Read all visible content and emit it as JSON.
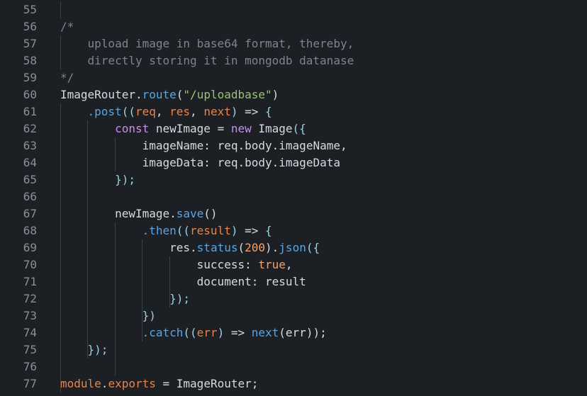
{
  "editor": {
    "lines": [
      {
        "number": "55",
        "indent": "",
        "tokens": []
      },
      {
        "number": "56",
        "indent": "",
        "tokens": [
          {
            "t": "/*",
            "c": "comment"
          }
        ]
      },
      {
        "number": "57",
        "indent": "    ",
        "tokens": [
          {
            "t": "upload image in base64 format, thereby,",
            "c": "comment"
          }
        ]
      },
      {
        "number": "58",
        "indent": "    ",
        "tokens": [
          {
            "t": "directly storing it in mongodb datanase",
            "c": "comment"
          }
        ]
      },
      {
        "number": "59",
        "indent": "",
        "tokens": [
          {
            "t": "*/",
            "c": "comment"
          }
        ]
      },
      {
        "number": "60",
        "indent": "",
        "tokens": [
          {
            "t": "ImageRouter",
            "c": "plain"
          },
          {
            "t": ".",
            "c": "punct"
          },
          {
            "t": "route",
            "c": "property"
          },
          {
            "t": "(",
            "c": "punct"
          },
          {
            "t": "\"/uploadbase\"",
            "c": "string"
          },
          {
            "t": ")",
            "c": "punct"
          }
        ]
      },
      {
        "number": "61",
        "indent": "    ",
        "tokens": [
          {
            "t": ".post",
            "c": "property"
          },
          {
            "t": "((",
            "c": "bracket"
          },
          {
            "t": "req",
            "c": "param"
          },
          {
            "t": ", ",
            "c": "plain"
          },
          {
            "t": "res",
            "c": "param"
          },
          {
            "t": ", ",
            "c": "plain"
          },
          {
            "t": "next",
            "c": "param"
          },
          {
            "t": ")",
            "c": "bracket"
          },
          {
            "t": " => ",
            "c": "arrow"
          },
          {
            "t": "{",
            "c": "bracket"
          }
        ]
      },
      {
        "number": "62",
        "indent": "        ",
        "tokens": [
          {
            "t": "const",
            "c": "keyword"
          },
          {
            "t": " newImage ",
            "c": "plain"
          },
          {
            "t": "=",
            "c": "plain"
          },
          {
            "t": " new ",
            "c": "keyword"
          },
          {
            "t": "Image",
            "c": "class"
          },
          {
            "t": "({",
            "c": "bracket"
          }
        ]
      },
      {
        "number": "63",
        "indent": "            ",
        "tokens": [
          {
            "t": "imageName",
            "c": "plain"
          },
          {
            "t": ": ",
            "c": "plain"
          },
          {
            "t": "req",
            "c": "plain"
          },
          {
            "t": ".",
            "c": "punct"
          },
          {
            "t": "body",
            "c": "plain"
          },
          {
            "t": ".",
            "c": "punct"
          },
          {
            "t": "imageName",
            "c": "plain"
          },
          {
            "t": ",",
            "c": "plain"
          }
        ]
      },
      {
        "number": "64",
        "indent": "            ",
        "tokens": [
          {
            "t": "imageData",
            "c": "plain"
          },
          {
            "t": ": ",
            "c": "plain"
          },
          {
            "t": "req",
            "c": "plain"
          },
          {
            "t": ".",
            "c": "punct"
          },
          {
            "t": "body",
            "c": "plain"
          },
          {
            "t": ".",
            "c": "punct"
          },
          {
            "t": "imageData",
            "c": "plain"
          }
        ]
      },
      {
        "number": "65",
        "indent": "        ",
        "tokens": [
          {
            "t": "});",
            "c": "bracket"
          }
        ]
      },
      {
        "number": "66",
        "indent": "",
        "tokens": []
      },
      {
        "number": "67",
        "indent": "        ",
        "tokens": [
          {
            "t": "newImage",
            "c": "plain"
          },
          {
            "t": ".",
            "c": "punct"
          },
          {
            "t": "save",
            "c": "property"
          },
          {
            "t": "()",
            "c": "punct"
          }
        ]
      },
      {
        "number": "68",
        "indent": "            ",
        "tokens": [
          {
            "t": ".then",
            "c": "property"
          },
          {
            "t": "((",
            "c": "bracket"
          },
          {
            "t": "result",
            "c": "param"
          },
          {
            "t": ")",
            "c": "bracket"
          },
          {
            "t": " => ",
            "c": "arrow"
          },
          {
            "t": "{",
            "c": "bracket"
          }
        ]
      },
      {
        "number": "69",
        "indent": "                ",
        "tokens": [
          {
            "t": "res",
            "c": "plain"
          },
          {
            "t": ".",
            "c": "punct"
          },
          {
            "t": "status",
            "c": "property"
          },
          {
            "t": "(",
            "c": "punct"
          },
          {
            "t": "200",
            "c": "number"
          },
          {
            "t": ")",
            "c": "punct"
          },
          {
            "t": ".",
            "c": "punct"
          },
          {
            "t": "json",
            "c": "property"
          },
          {
            "t": "({",
            "c": "bracket"
          }
        ]
      },
      {
        "number": "70",
        "indent": "                    ",
        "tokens": [
          {
            "t": "success",
            "c": "plain"
          },
          {
            "t": ": ",
            "c": "plain"
          },
          {
            "t": "true",
            "c": "boolean"
          },
          {
            "t": ",",
            "c": "plain"
          }
        ]
      },
      {
        "number": "71",
        "indent": "                    ",
        "tokens": [
          {
            "t": "document",
            "c": "plain"
          },
          {
            "t": ": ",
            "c": "plain"
          },
          {
            "t": "result",
            "c": "plain"
          }
        ]
      },
      {
        "number": "72",
        "indent": "                ",
        "tokens": [
          {
            "t": "});",
            "c": "bracket"
          }
        ]
      },
      {
        "number": "73",
        "indent": "            ",
        "tokens": [
          {
            "t": "})",
            "c": "bracket"
          }
        ]
      },
      {
        "number": "74",
        "indent": "            ",
        "tokens": [
          {
            "t": ".catch",
            "c": "property"
          },
          {
            "t": "((",
            "c": "bracket"
          },
          {
            "t": "err",
            "c": "param"
          },
          {
            "t": ")",
            "c": "bracket"
          },
          {
            "t": " => ",
            "c": "arrow"
          },
          {
            "t": "next",
            "c": "property"
          },
          {
            "t": "(",
            "c": "punct"
          },
          {
            "t": "err",
            "c": "plain"
          },
          {
            "t": "));",
            "c": "punct"
          }
        ]
      },
      {
        "number": "75",
        "indent": "    ",
        "tokens": [
          {
            "t": "});",
            "c": "bracket"
          }
        ]
      },
      {
        "number": "76",
        "indent": "",
        "tokens": []
      },
      {
        "number": "77",
        "indent": "",
        "tokens": [
          {
            "t": "module",
            "c": "param"
          },
          {
            "t": ".",
            "c": "punct"
          },
          {
            "t": "exports",
            "c": "param"
          },
          {
            "t": " = ",
            "c": "plain"
          },
          {
            "t": "ImageRouter",
            "c": "plain"
          },
          {
            "t": ";",
            "c": "plain"
          }
        ]
      }
    ]
  }
}
